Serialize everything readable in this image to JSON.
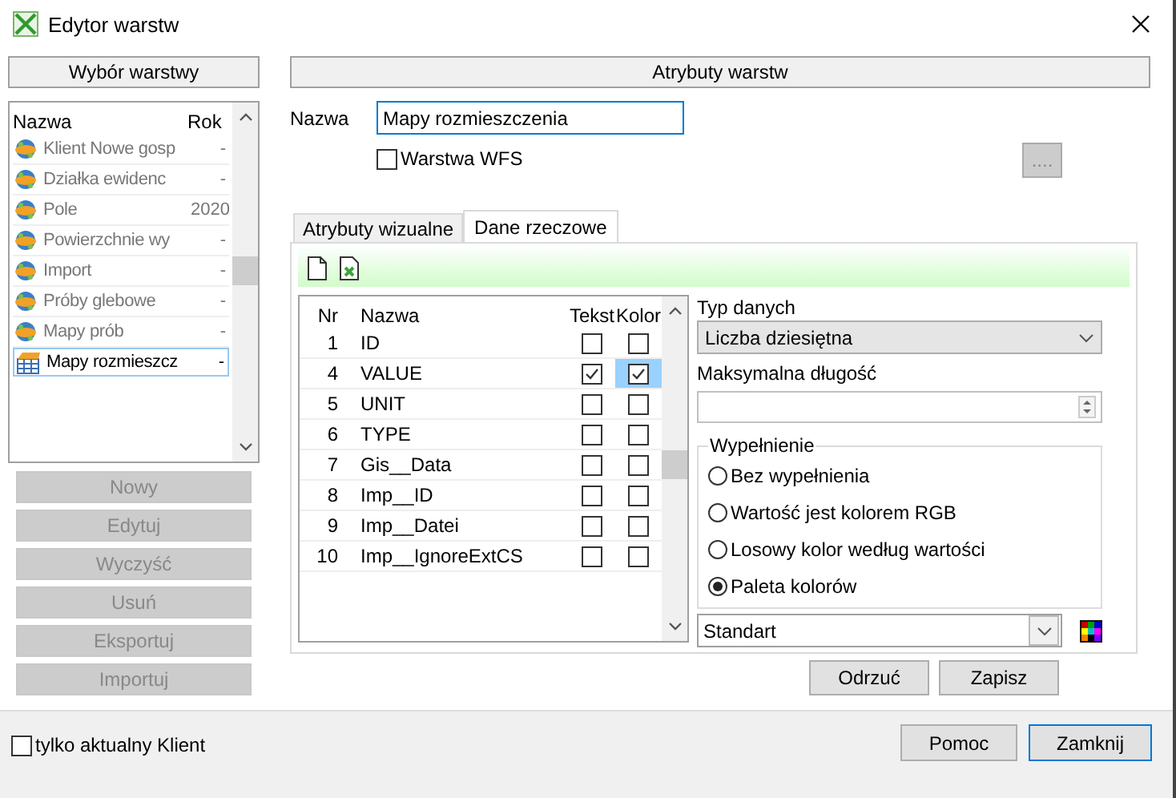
{
  "window": {
    "title": "Edytor warstw"
  },
  "left": {
    "header": "Wybór warstwy",
    "columns": [
      "Nazwa",
      "Rok"
    ],
    "layers": [
      {
        "name": "Klient Nowe gosp",
        "year": "-",
        "kind": "service",
        "selected": false
      },
      {
        "name": "Działka ewidenc",
        "year": "-",
        "kind": "service",
        "selected": false
      },
      {
        "name": "Pole",
        "year": "2020",
        "kind": "service",
        "selected": false
      },
      {
        "name": "Powierzchnie wy",
        "year": "-",
        "kind": "service",
        "selected": false
      },
      {
        "name": "Import",
        "year": "-",
        "kind": "service",
        "selected": false
      },
      {
        "name": "Próby glebowe",
        "year": "-",
        "kind": "service",
        "selected": false
      },
      {
        "name": "Mapy prób",
        "year": "-",
        "kind": "service",
        "selected": false
      },
      {
        "name": "Mapy rozmieszcz",
        "year": "-",
        "kind": "table",
        "selected": true
      }
    ],
    "buttons": [
      {
        "label": "Nowy",
        "disabled": true
      },
      {
        "label": "Edytuj",
        "disabled": true
      },
      {
        "label": "Wyczyść",
        "disabled": true
      },
      {
        "label": "Usuń",
        "disabled": true
      },
      {
        "label": "Eksportuj",
        "disabled": true
      },
      {
        "label": "Importuj",
        "disabled": true
      }
    ]
  },
  "right": {
    "header": "Atrybuty warstw",
    "name_label": "Nazwa",
    "name_value": "Mapy rozmieszczenia",
    "wfs": {
      "label": "Warstwa WFS",
      "checked": false
    },
    "more_button": {
      "label": "....",
      "disabled": true
    },
    "tabs": [
      {
        "label": "Atrybuty wizualne",
        "selected": false
      },
      {
        "label": "Dane rzeczowe",
        "selected": true
      }
    ],
    "fields": {
      "columns": [
        "Nr",
        "Nazwa",
        "Tekst",
        "Kolor"
      ],
      "rows": [
        {
          "nr": "1",
          "name": "ID",
          "text": false,
          "color": false,
          "selected": false
        },
        {
          "nr": "4",
          "name": "VALUE",
          "text": true,
          "color": true,
          "selected": true
        },
        {
          "nr": "5",
          "name": "UNIT",
          "text": false,
          "color": false,
          "selected": false
        },
        {
          "nr": "6",
          "name": "TYPE",
          "text": false,
          "color": false,
          "selected": false
        },
        {
          "nr": "7",
          "name": "Gis__Data",
          "text": false,
          "color": false,
          "selected": false
        },
        {
          "nr": "8",
          "name": "Imp__ID",
          "text": false,
          "color": false,
          "selected": false
        },
        {
          "nr": "9",
          "name": "Imp__Datei",
          "text": false,
          "color": false,
          "selected": false
        },
        {
          "nr": "10",
          "name": "Imp__IgnoreExtCS",
          "text": false,
          "color": false,
          "selected": false
        }
      ]
    },
    "data_type": {
      "label": "Typ danych",
      "value": "Liczba dziesiętna"
    },
    "max_length": {
      "label": "Maksymalna długość"
    },
    "fill": {
      "legend": "Wypełnienie",
      "options": [
        {
          "label": "Bez wypełnienia",
          "selected": false
        },
        {
          "label": "Wartość jest kolorem RGB",
          "selected": false
        },
        {
          "label": "Losowy kolor według wartości",
          "selected": false
        },
        {
          "label": "Paleta kolorów",
          "selected": true
        }
      ]
    },
    "palette": "Standart",
    "actions": [
      "Odrzuć",
      "Zapisz"
    ]
  },
  "footer": {
    "only_current": {
      "label": "tylko aktualny Klient",
      "checked": false
    },
    "buttons": [
      {
        "label": "Pomoc",
        "default": false
      },
      {
        "label": "Zamknij",
        "default": true
      }
    ]
  }
}
